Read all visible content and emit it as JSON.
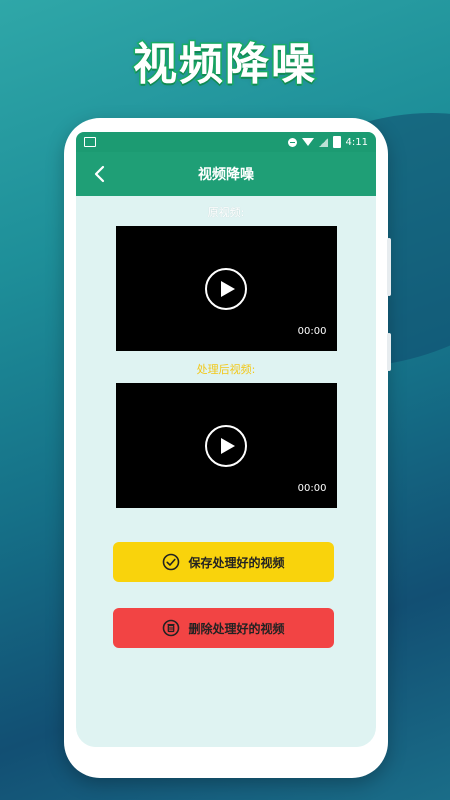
{
  "promo": {
    "title": "视频降噪"
  },
  "status_bar": {
    "time": "4:11",
    "icons": [
      "image-icon",
      "dnd-icon",
      "wifi-icon",
      "signal-off-icon",
      "battery-icon"
    ]
  },
  "app_bar": {
    "title": "视频降噪",
    "back_icon": "chevron-left-icon"
  },
  "original_video": {
    "label": "原视频:",
    "time": "00:00"
  },
  "processed_video": {
    "label": "处理后视频:",
    "time": "00:00"
  },
  "actions": {
    "save_label": "保存处理好的视频",
    "delete_label": "删除处理好的视频"
  },
  "colors": {
    "brand_green": "#1f9f76",
    "save_yellow": "#f9d30c",
    "delete_red": "#f24444",
    "processed_label": "#f2c81a",
    "screen_bg": "#dff3f2"
  }
}
